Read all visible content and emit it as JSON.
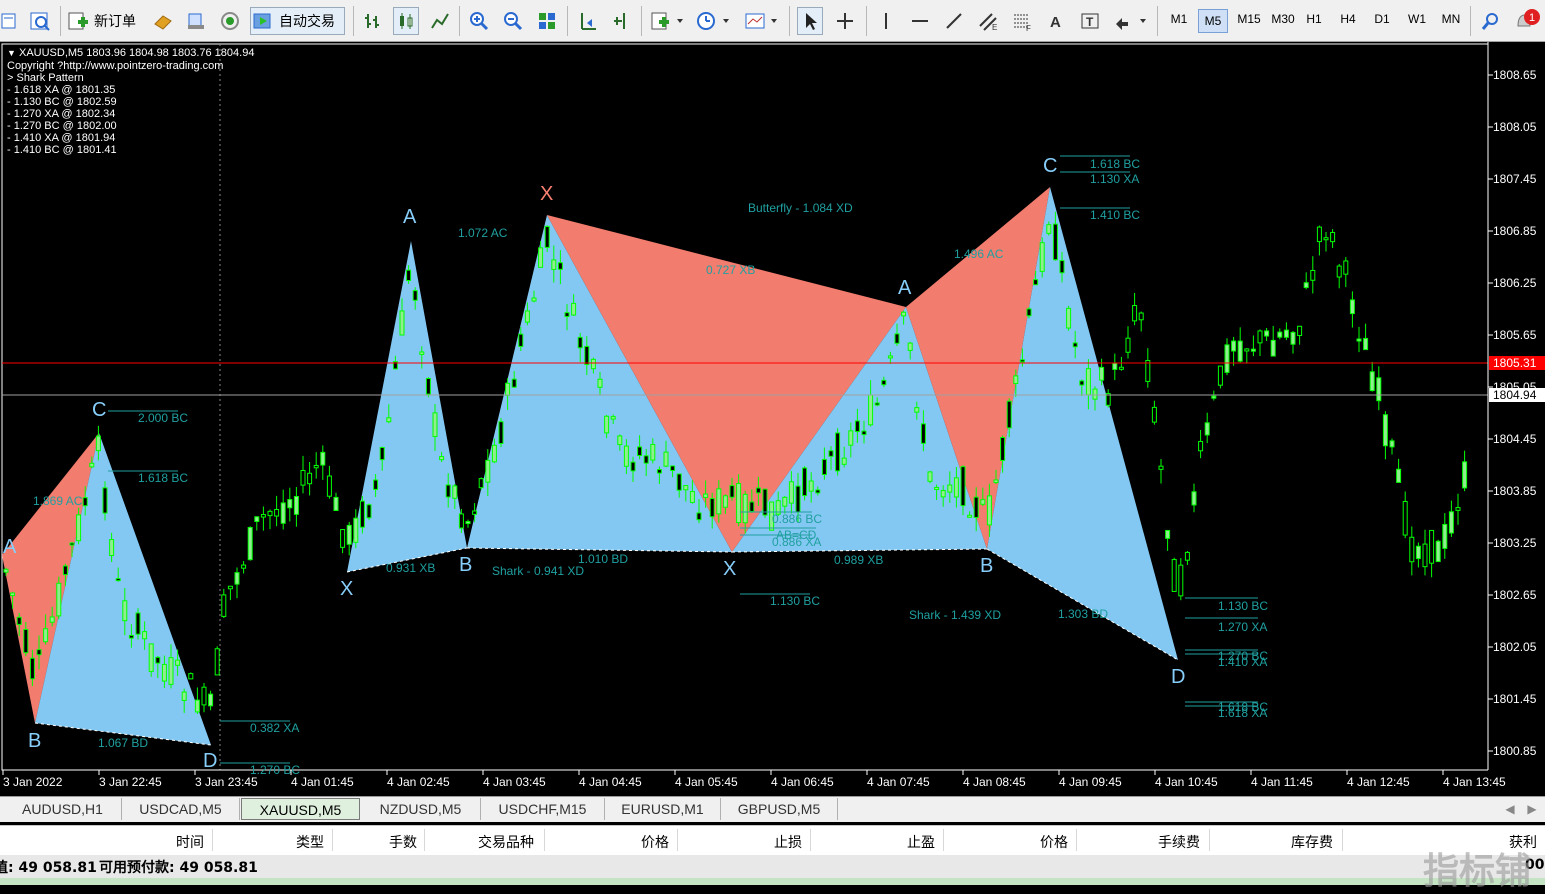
{
  "toolbar": {
    "new_order_label": "新订单",
    "auto_trade_label": "自动交易",
    "timeframes": [
      "M1",
      "M5",
      "M15",
      "M30",
      "H1",
      "H4",
      "D1",
      "W1",
      "MN"
    ],
    "active_timeframe": "M5",
    "notification_count": "1"
  },
  "chart": {
    "header": "XAUUSD,M5  1803.96 1804.98 1803.76 1804.94",
    "copyright": "Copyright ?http://www.pointzero-trading.com",
    "pattern_title": "> Shark Pattern",
    "pattern_lines": [
      "- 1.618 XA @ 1801.35",
      "- 1.130 BC @ 1802.59",
      "- 1.270 XA @ 1802.34",
      "- 1.270 BC @ 1802.00",
      "- 1.410 XA @ 1801.94",
      "- 1.410 BC @ 1801.41"
    ],
    "price_levels": [
      "1808.65",
      "1808.05",
      "1807.45",
      "1806.85",
      "1806.25",
      "1805.65",
      "1805.05",
      "1804.45",
      "1803.85",
      "1803.25",
      "1802.65",
      "1802.05",
      "1801.45",
      "1800.85"
    ],
    "bid_price": "1805.31",
    "last_price": "1804.94",
    "time_labels": [
      "3 Jan 2022",
      "3 Jan 22:45",
      "3 Jan 23:45",
      "4 Jan 01:45",
      "4 Jan 02:45",
      "4 Jan 03:45",
      "4 Jan 04:45",
      "4 Jan 05:45",
      "4 Jan 06:45",
      "4 Jan 07:45",
      "4 Jan 08:45",
      "4 Jan 09:45",
      "4 Jan 10:45",
      "4 Jan 11:45",
      "4 Jan 12:45",
      "4 Jan 13:45"
    ],
    "point_labels": [
      "A",
      "B",
      "C",
      "D",
      "X",
      "A",
      "B",
      "X",
      "A",
      "X",
      "B",
      "C",
      "D"
    ],
    "ratio_labels": [
      "2.000 BC",
      "1.618 BC",
      "1.869 AC",
      "1.067 BD",
      "0.382 XA",
      "1.270 BC",
      "0.931 XB",
      "1.072 AC",
      "Shark - 0.941 XD",
      "1.010 BD",
      "0.727 XB",
      "Butterfly - 1.084 XD",
      "0.886 BC",
      "AB=CD",
      "0.886 XA",
      "1.130 BC",
      "0.989 XB",
      "1.496 AC",
      "1.618 BC",
      "1.130 XA",
      "1.410 BC",
      "Shark - 1.439 XD",
      "1.303 BD",
      "1.130 BC",
      "1.270 XA",
      "1.270 BC",
      "1.410 XA",
      "1.618 BC",
      "1.618 XA"
    ]
  },
  "tabs": [
    "AUDUSD,H1",
    "USDCAD,M5",
    "XAUUSD,M5",
    "NZDUSD,M5",
    "USDCHF,M15",
    "EURUSD,M1",
    "GBPUSD,M5"
  ],
  "active_tab": "XAUUSD,M5",
  "columns": [
    "时间",
    "类型",
    "手数",
    "交易品种",
    "价格",
    "止损",
    "止盈",
    "价格",
    "手续费",
    "库存费",
    "获利"
  ],
  "balance": {
    "equity_text": "值: 49 058.81",
    "free_margin_text": "可用预付款: 49 058.81",
    "profit_edge": "00"
  },
  "watermark": "指标铺",
  "colors": {
    "bull_candle": "#00ff00",
    "bear_fill": "#90ee90",
    "pattern_blue": "#87cefa",
    "pattern_red": "#fa8072",
    "label_text": "#20a0a0",
    "bid_line": "#ff0000",
    "last_line": "#a0a0a0"
  },
  "icons": [
    "new-chart-icon",
    "profiles-icon",
    "new-order-icon",
    "market-watch-icon",
    "navigator-icon",
    "signals-icon",
    "auto-trade-icon",
    "bar-chart-icon",
    "candles-icon",
    "line-chart-icon",
    "zoom-in-icon",
    "zoom-out-icon",
    "tile-icon",
    "scroll-icon",
    "shift-icon",
    "indicators-icon",
    "periods-icon",
    "templates-icon",
    "cursor-icon",
    "crosshair-icon",
    "vertical-line-icon",
    "horizontal-line-icon",
    "trendline-icon",
    "channel-icon",
    "fibo-icon",
    "text-icon",
    "label-icon",
    "arrows-icon",
    "search-icon",
    "bell-icon"
  ]
}
